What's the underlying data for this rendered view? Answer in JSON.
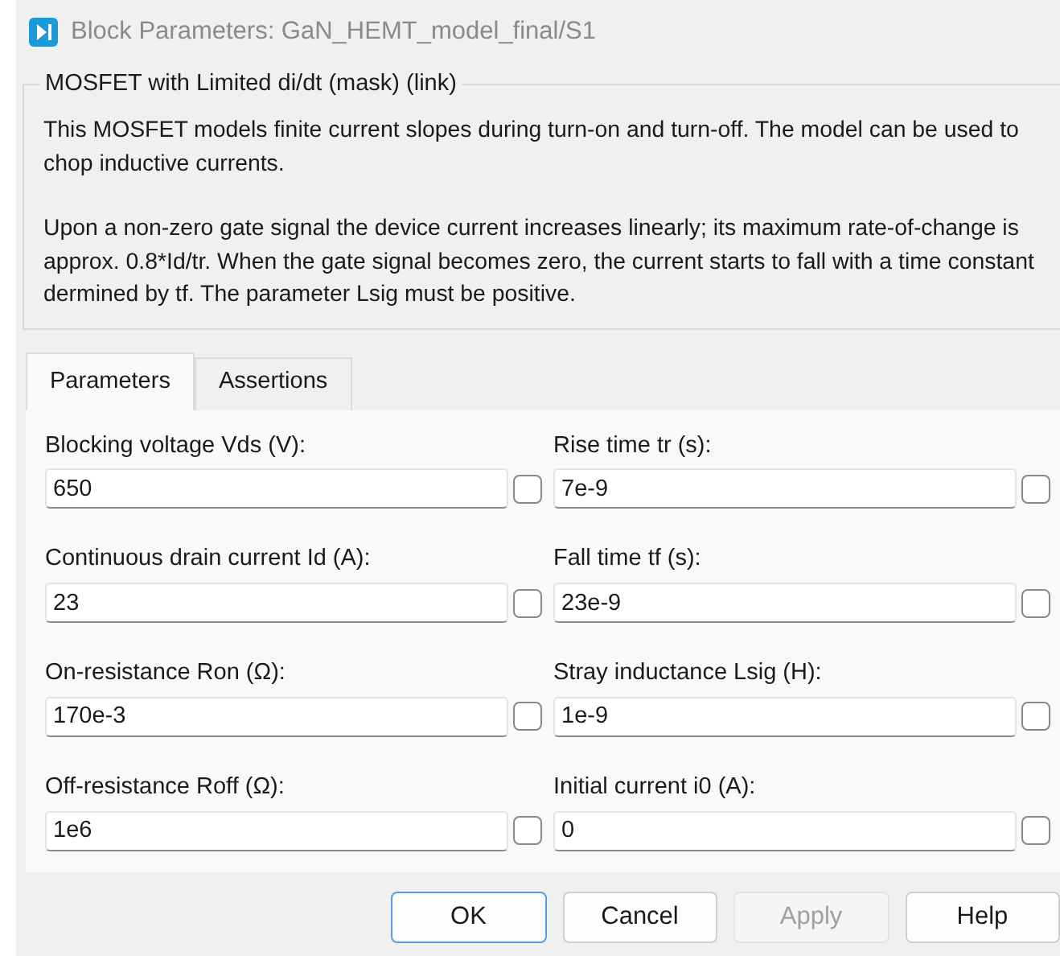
{
  "window": {
    "title": "Block Parameters: GaN_HEMT_model_final/S1"
  },
  "group": {
    "title": "MOSFET with Limited di/dt (mask) (link)",
    "paragraphs": [
      "This MOSFET models finite current slopes during turn-on and turn-off. The model can be used to chop inductive currents.",
      "Upon a non-zero gate signal the device current increases linearly; its maximum rate-of-change is approx. 0.8*Id/tr. When the gate signal becomes zero, the current starts to fall with a time constant dermined by tf. The parameter Lsig must be positive."
    ]
  },
  "tabs": [
    {
      "label": "Parameters",
      "selected": true
    },
    {
      "label": "Assertions",
      "selected": false
    }
  ],
  "parameters": [
    {
      "label": "Blocking voltage Vds (V):",
      "value": "650",
      "checked": false
    },
    {
      "label": "Rise time tr (s):",
      "value": "7e-9",
      "checked": false
    },
    {
      "label": "Continuous drain current Id (A):",
      "value": "23",
      "checked": false
    },
    {
      "label": "Fall time tf (s):",
      "value": "23e-9",
      "checked": false
    },
    {
      "label": "On-resistance Ron (Ω):",
      "value": "170e-3",
      "checked": false
    },
    {
      "label": "Stray inductance Lsig (H):",
      "value": "1e-9",
      "checked": false
    },
    {
      "label": "Off-resistance Roff (Ω):",
      "value": "1e6",
      "checked": false
    },
    {
      "label": "Initial current i0 (A):",
      "value": "0",
      "checked": false
    }
  ],
  "buttons": [
    {
      "label": "OK",
      "default": true,
      "disabled": false
    },
    {
      "label": "Cancel",
      "default": false,
      "disabled": false
    },
    {
      "label": "Apply",
      "default": false,
      "disabled": true
    },
    {
      "label": "Help",
      "default": false,
      "disabled": false
    }
  ]
}
